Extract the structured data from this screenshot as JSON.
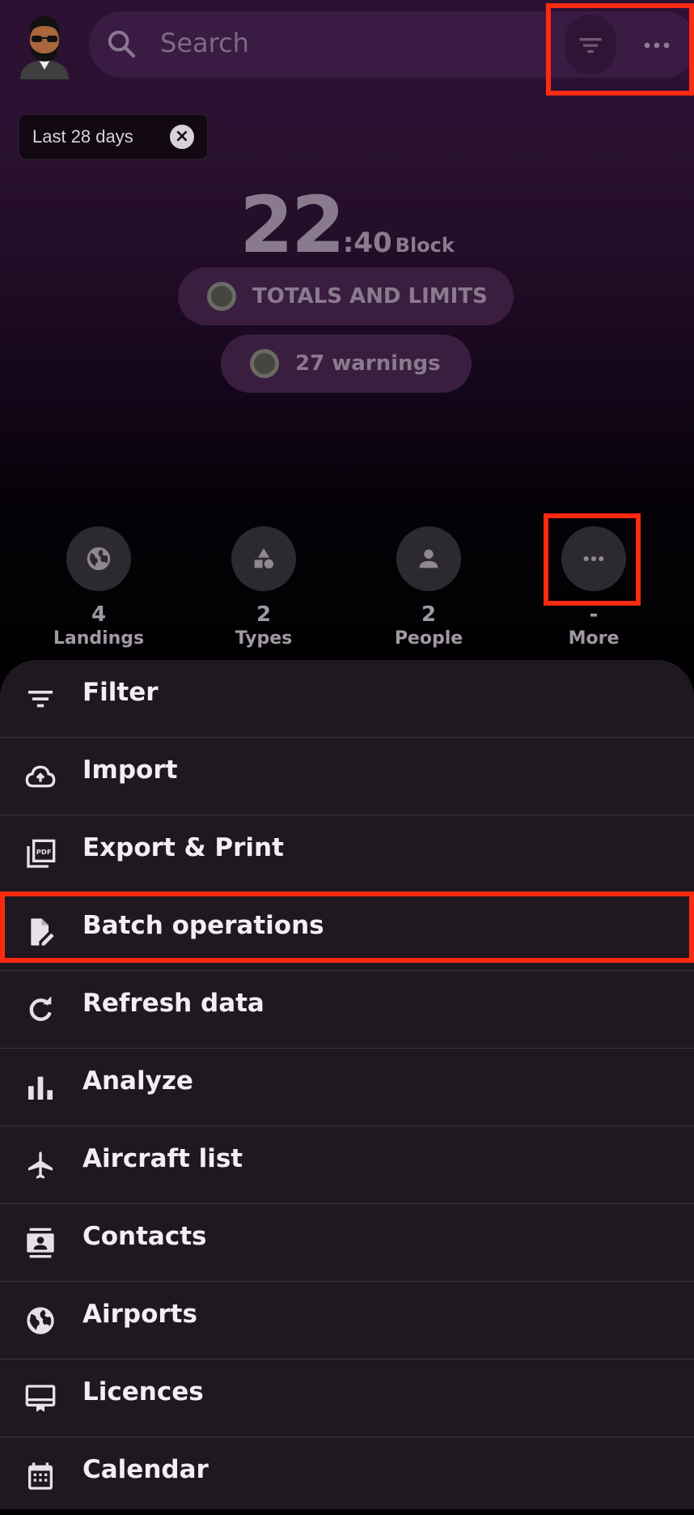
{
  "header": {
    "search_placeholder": "Search",
    "filter_chip": "Last 28 days"
  },
  "summary": {
    "block_hours": "22",
    "block_minutes": ":40",
    "block_label": "Block",
    "totals_label": "TOTALS AND LIMITS",
    "warnings_label": "27 warnings"
  },
  "stats": [
    {
      "value": "4",
      "label": "Landings",
      "icon": "globe-icon"
    },
    {
      "value": "2",
      "label": "Types",
      "icon": "shapes-icon"
    },
    {
      "value": "2",
      "label": "People",
      "icon": "person-icon"
    },
    {
      "value": "-",
      "label": "More",
      "icon": "more-icon"
    }
  ],
  "menu": [
    {
      "label": "Filter",
      "icon": "filter-icon"
    },
    {
      "label": "Import",
      "icon": "cloud-upload-icon"
    },
    {
      "label": "Export & Print",
      "icon": "pdf-icon"
    },
    {
      "label": "Batch operations",
      "icon": "edit-document-icon"
    },
    {
      "label": "Refresh data",
      "icon": "refresh-icon"
    },
    {
      "label": "Analyze",
      "icon": "bar-chart-icon"
    },
    {
      "label": "Aircraft list",
      "icon": "airplane-icon"
    },
    {
      "label": "Contacts",
      "icon": "contacts-icon"
    },
    {
      "label": "Airports",
      "icon": "globe-icon"
    },
    {
      "label": "Licences",
      "icon": "licence-icon"
    },
    {
      "label": "Calendar",
      "icon": "calendar-icon"
    }
  ],
  "colors": {
    "accent_highlight": "#ff2a10",
    "sheet_bg": "#201820",
    "header_bg": "#2c1133"
  }
}
